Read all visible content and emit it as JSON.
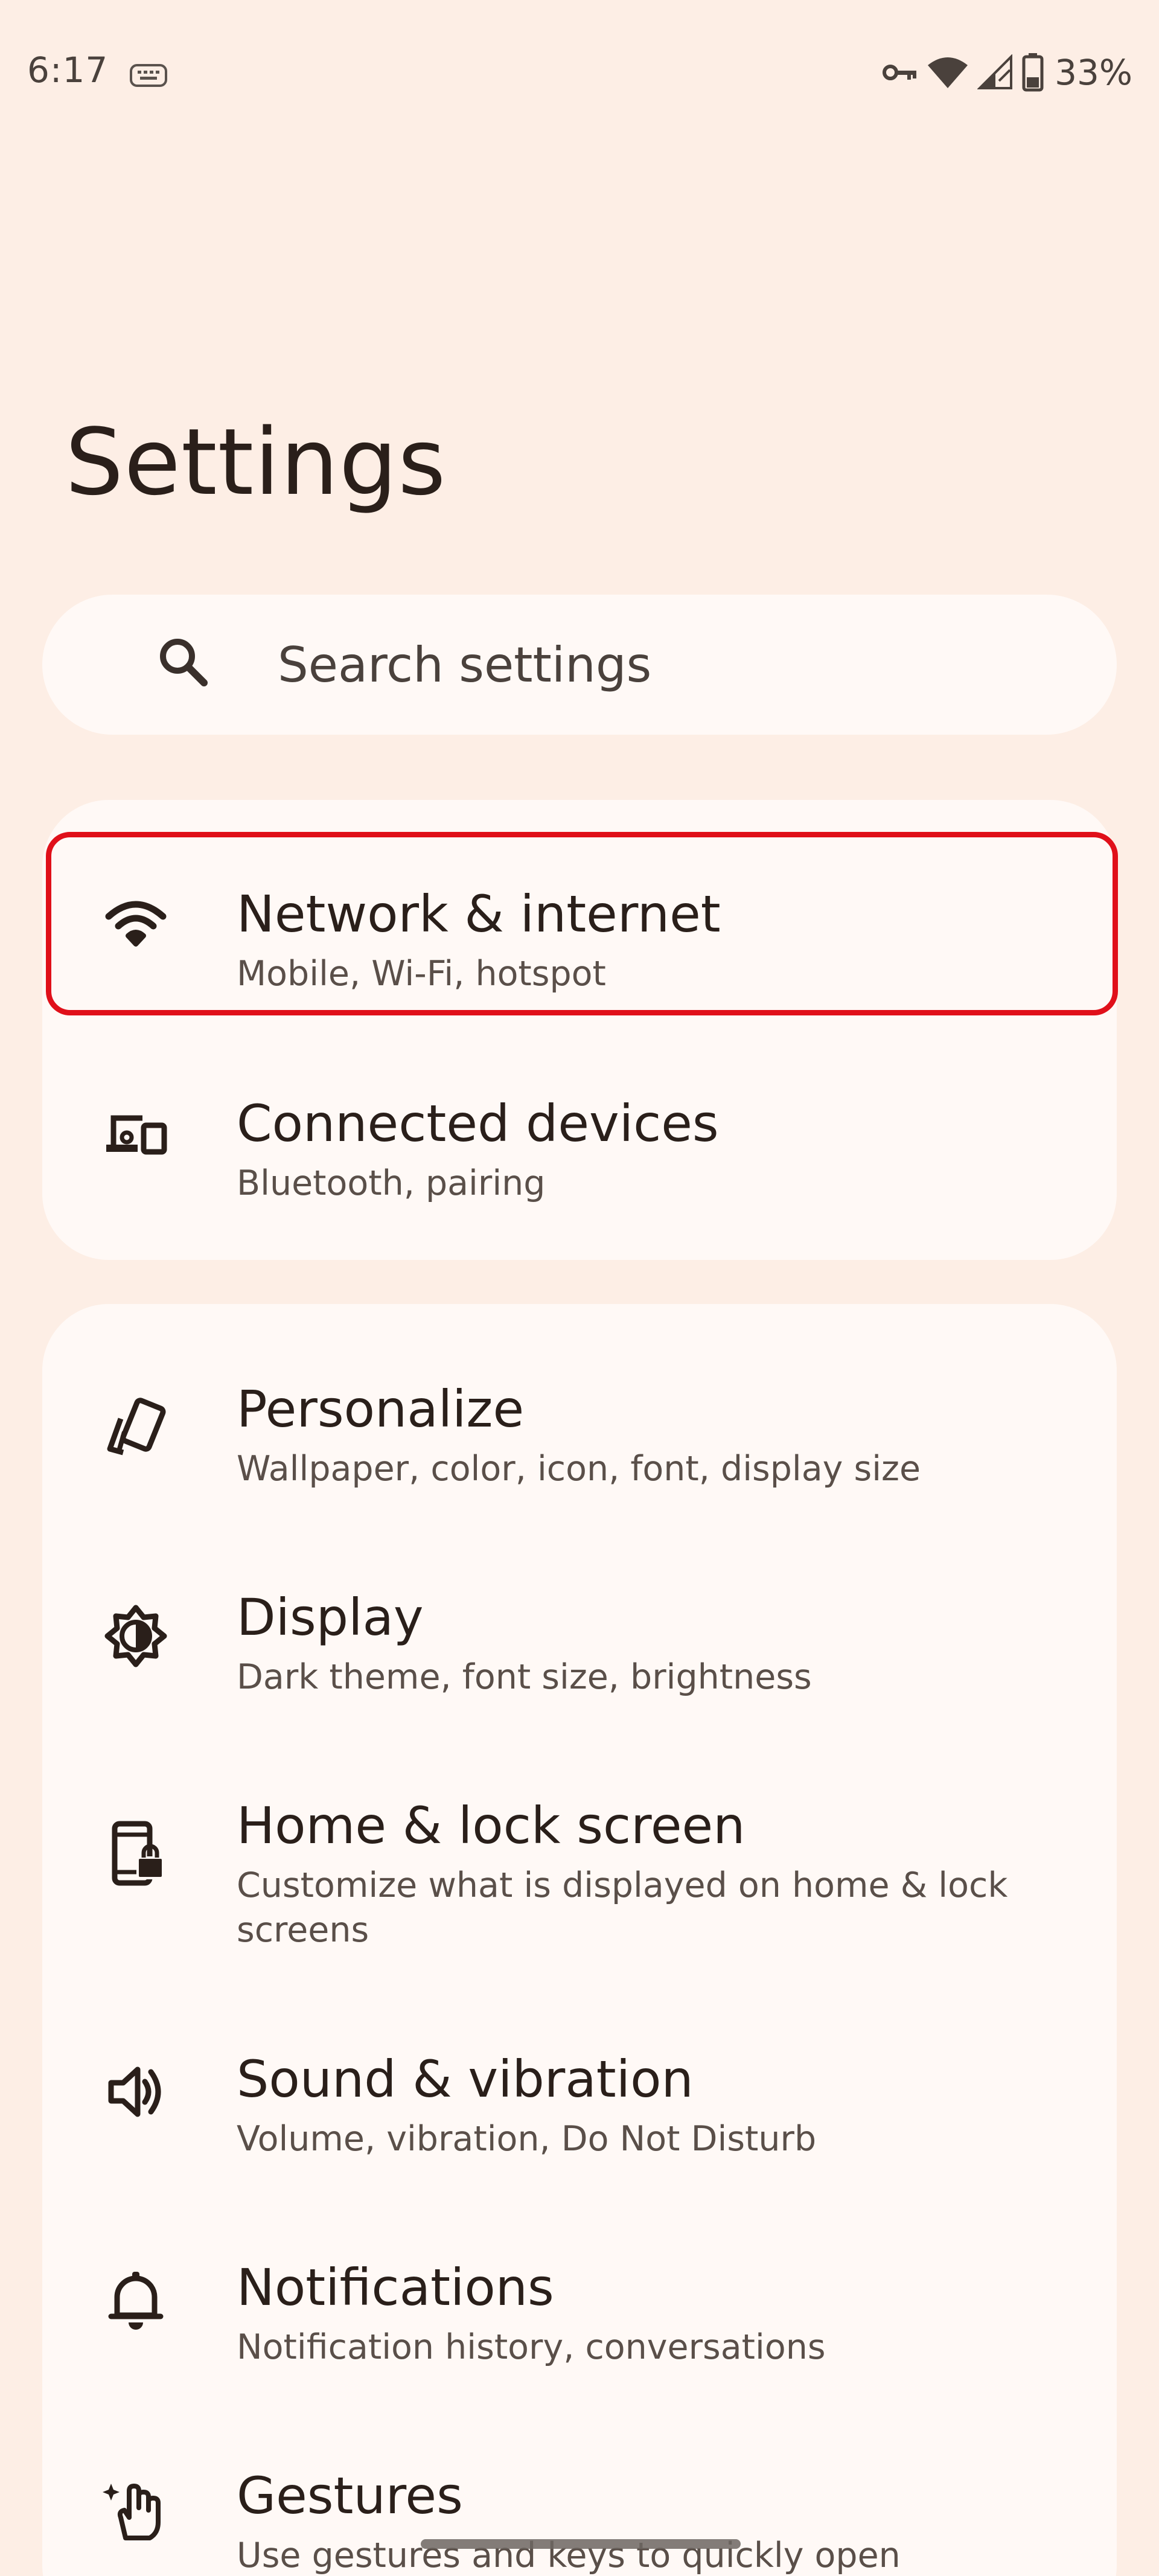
{
  "status_bar": {
    "time": "6:17",
    "left_icon": "keyboard-icon",
    "right_icons": [
      "vpn-key-icon",
      "wifi-icon",
      "cellular-signal-icon",
      "battery-icon"
    ],
    "battery_percent": "33%"
  },
  "page": {
    "title": "Settings"
  },
  "search": {
    "placeholder": "Search settings",
    "value": ""
  },
  "groups": [
    {
      "items": [
        {
          "icon": "wifi-icon",
          "title": "Network & internet",
          "subtitle": "Mobile, Wi-Fi, hotspot",
          "highlighted": true
        },
        {
          "icon": "connected-devices-icon",
          "title": "Connected devices",
          "subtitle": "Bluetooth, pairing"
        }
      ]
    },
    {
      "items": [
        {
          "icon": "palette-icon",
          "title": "Personalize",
          "subtitle": "Wallpaper, color, icon, font, display size"
        },
        {
          "icon": "brightness-icon",
          "title": "Display",
          "subtitle": "Dark theme, font size, brightness"
        },
        {
          "icon": "phone-lock-icon",
          "title": "Home & lock screen",
          "subtitle": "Customize what is displayed on home & lock screens"
        },
        {
          "icon": "volume-icon",
          "title": "Sound & vibration",
          "subtitle": "Volume, vibration, Do Not Disturb"
        },
        {
          "icon": "bell-icon",
          "title": "Notifications",
          "subtitle": "Notification history, conversations"
        },
        {
          "icon": "gesture-hand-icon",
          "title": "Gestures",
          "subtitle": "Use gestures and keys to quickly open"
        }
      ]
    }
  ],
  "colors": {
    "background": "#fdeee5",
    "card": "#fff9f6",
    "highlight": "#e0101a",
    "text_primary": "#2a1f1a",
    "text_secondary": "#5a4f49"
  }
}
